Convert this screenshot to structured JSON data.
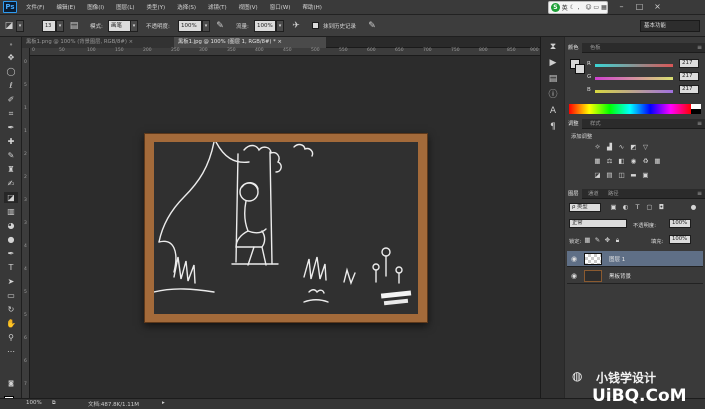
{
  "app": {
    "logo": "Ps"
  },
  "menu": [
    "文件(F)",
    "编辑(E)",
    "图像(I)",
    "图层(L)",
    "类型(Y)",
    "选择(S)",
    "滤镜(T)",
    "视图(V)",
    "窗口(W)",
    "帮助(H)"
  ],
  "ime": {
    "label": "英",
    "icons": [
      "moon-icon",
      "comma-icon",
      "emoji-icon",
      "keyboard-icon",
      "shirt-icon",
      "grid-icon"
    ]
  },
  "window_controls": [
    "minimize",
    "restore",
    "close"
  ],
  "options": {
    "brush_size": "13",
    "mode_label": "模式:",
    "mode_value": "画笔",
    "opacity_label": "不透明度:",
    "opacity_value": "100%",
    "flow_label": "流量:",
    "flow_value": "100%",
    "erase_history_label": "抹到历史记录",
    "workspace": "基本功能"
  },
  "tabs": [
    {
      "label": "黑板1.png @ 100% (背景图层, RGB/8#) ×",
      "active": false
    },
    {
      "label": "黑板1.jpg @ 100% (图层 1, RGB/8#) * ×",
      "active": true
    }
  ],
  "ruler": {
    "top": [
      "0",
      "50",
      "100",
      "150",
      "200",
      "250",
      "300",
      "350",
      "400",
      "450",
      "500",
      "550",
      "600",
      "650",
      "700",
      "750",
      "800",
      "850",
      "900"
    ],
    "left": [
      "0",
      "5",
      "1",
      "1",
      "2",
      "2",
      "3",
      "3",
      "4",
      "4",
      "5",
      "5",
      "6",
      "6",
      "7"
    ]
  },
  "color_panel": {
    "tabs": [
      "颜色",
      "色板"
    ],
    "sliders": [
      {
        "label": "R",
        "value": "217",
        "color": "#d96161"
      },
      {
        "label": "G",
        "value": "217",
        "color": "#58c958"
      },
      {
        "label": "B",
        "value": "217",
        "color": "#b070d8"
      }
    ]
  },
  "adjust_panel": {
    "tabs": [
      "调整",
      "样式"
    ],
    "title": "添加调整"
  },
  "layers_panel": {
    "tabs": [
      "图层",
      "通道",
      "路径"
    ],
    "filter_label": "ρ 类型",
    "blend_mode": "正常",
    "opacity_label": "不透明度:",
    "opacity_value": "100%",
    "lock_label": "锁定:",
    "fill_label": "填充:",
    "fill_value": "100%",
    "layers": [
      {
        "name": "图层 1",
        "selected": true
      },
      {
        "name": "黑板背景",
        "selected": false
      }
    ]
  },
  "status": {
    "zoom": "100%",
    "doc_info": "文档:487.8K/1.11M"
  },
  "watermark": {
    "line1": "小钱学设计",
    "line2": "UiBQ.CoM"
  }
}
